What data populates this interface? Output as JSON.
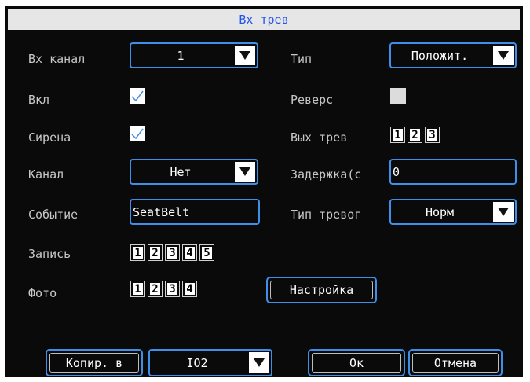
{
  "window": {
    "title": "Вх трев"
  },
  "labels": {
    "input_channel": "Вх канал",
    "type": "Тип",
    "enable": "Вкл",
    "reverse": "Реверс",
    "siren": "Сирена",
    "alarm_out": "Вых трев",
    "channel": "Канал",
    "delay": "Задержка(с",
    "event": "Событие",
    "alarm_type": "Тип тревог",
    "record": "Запись",
    "photo": "Фото"
  },
  "fields": {
    "input_channel": {
      "value": "1"
    },
    "type": {
      "value": "Положит."
    },
    "enable": {
      "checked": true
    },
    "reverse": {
      "checked": false
    },
    "siren": {
      "checked": true
    },
    "alarm_out": [
      "1",
      "2",
      "3"
    ],
    "channel": {
      "value": "Нет"
    },
    "delay": {
      "value": "0"
    },
    "event": {
      "value": "SeatBelt"
    },
    "alarm_type": {
      "value": "Норм"
    },
    "record": [
      "1",
      "2",
      "3",
      "4",
      "5"
    ],
    "photo": [
      "1",
      "2",
      "3",
      "4"
    ]
  },
  "buttons": {
    "setup": "Настройка",
    "copy_to": "Копир. в",
    "copy_target": "IO2",
    "ok": "Ок",
    "cancel": "Отмена"
  },
  "colors": {
    "background": "#0a0a0a",
    "accent_border": "#3f8fe8",
    "title_bar": "#e6e6e6",
    "title_text": "#2255ee",
    "label_text": "#c8c8c8",
    "check_mark": "#3f8fe8"
  }
}
